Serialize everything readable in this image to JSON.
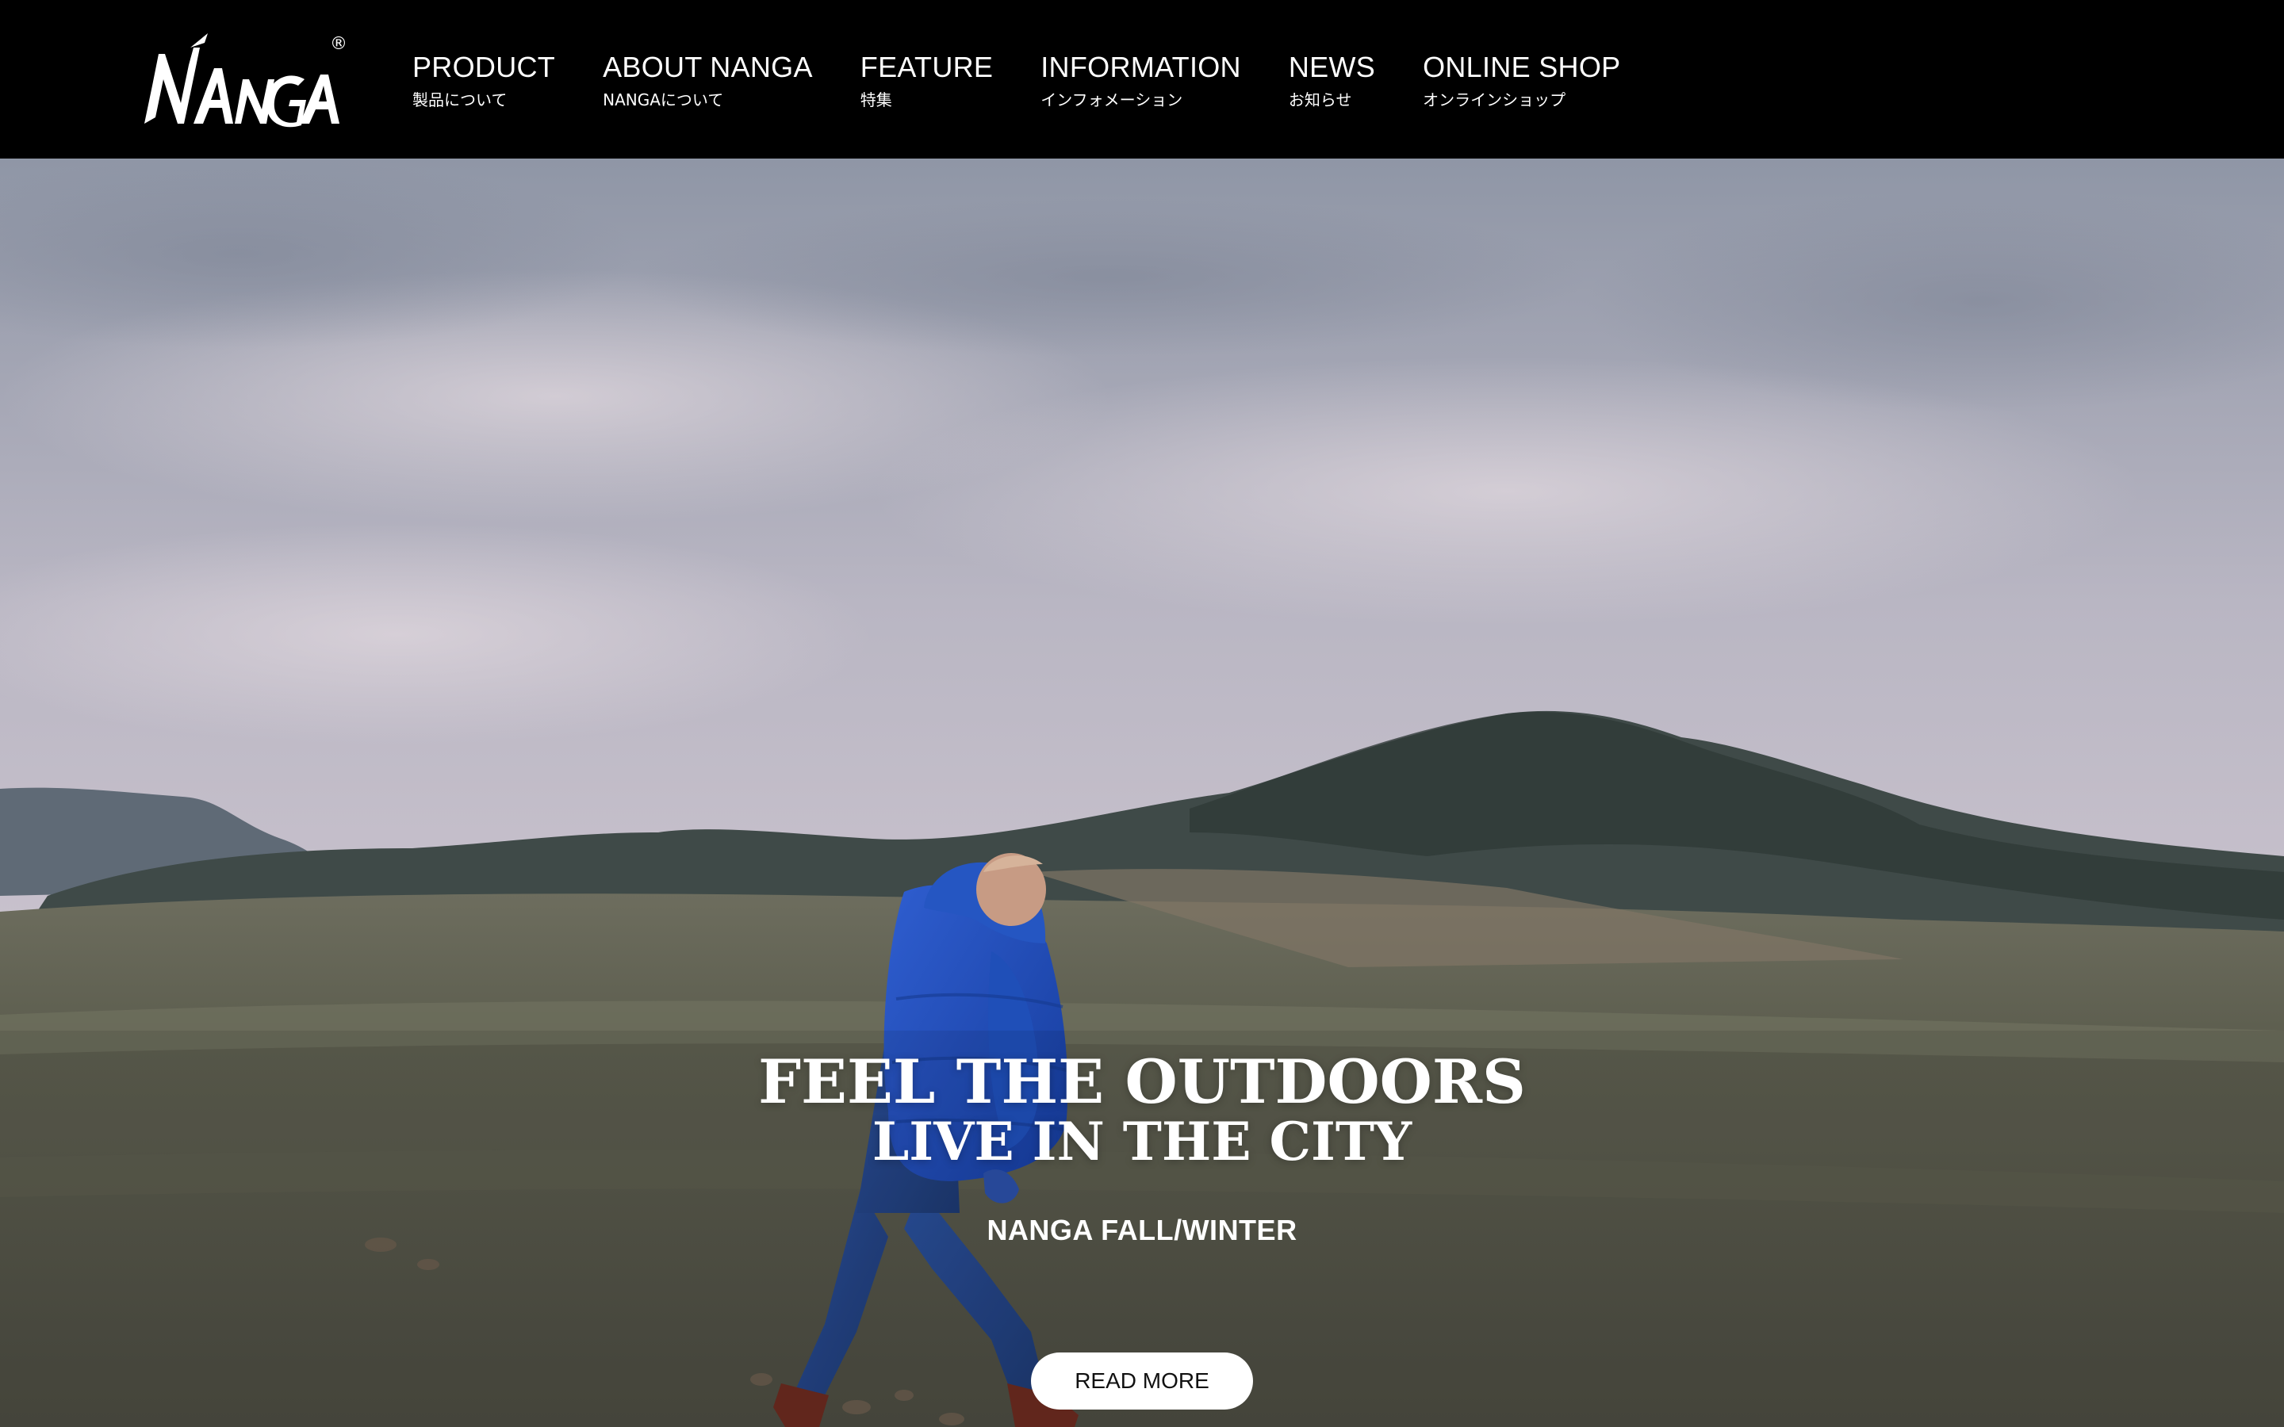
{
  "brand": {
    "logo_text": "NANGA",
    "registered_mark": "®",
    "logo_icon": "nanga-wordmark-logo"
  },
  "nav": {
    "items": [
      {
        "label": "PRODUCT",
        "sub": "製品について"
      },
      {
        "label": "ABOUT NANGA",
        "sub": "NANGAについて"
      },
      {
        "label": "FEATURE",
        "sub": "特集"
      },
      {
        "label": "INFORMATION",
        "sub": "インフォメーション"
      },
      {
        "label": "NEWS",
        "sub": "お知らせ"
      },
      {
        "label": "ONLINE SHOP",
        "sub": "オンラインショップ"
      }
    ]
  },
  "hero": {
    "headline_line1": "FEEL THE OUTDOORS",
    "headline_line2": "LIVE IN THE CITY",
    "season": "NANGA FALL/WINTER",
    "cta_label": "READ MORE",
    "background": "person-in-blue-down-jacket-walking-grassland-mountain-image"
  },
  "colors": {
    "header_bg": "#000000",
    "text": "#ffffff",
    "cta_bg": "#ffffff",
    "cta_text": "#111111"
  }
}
